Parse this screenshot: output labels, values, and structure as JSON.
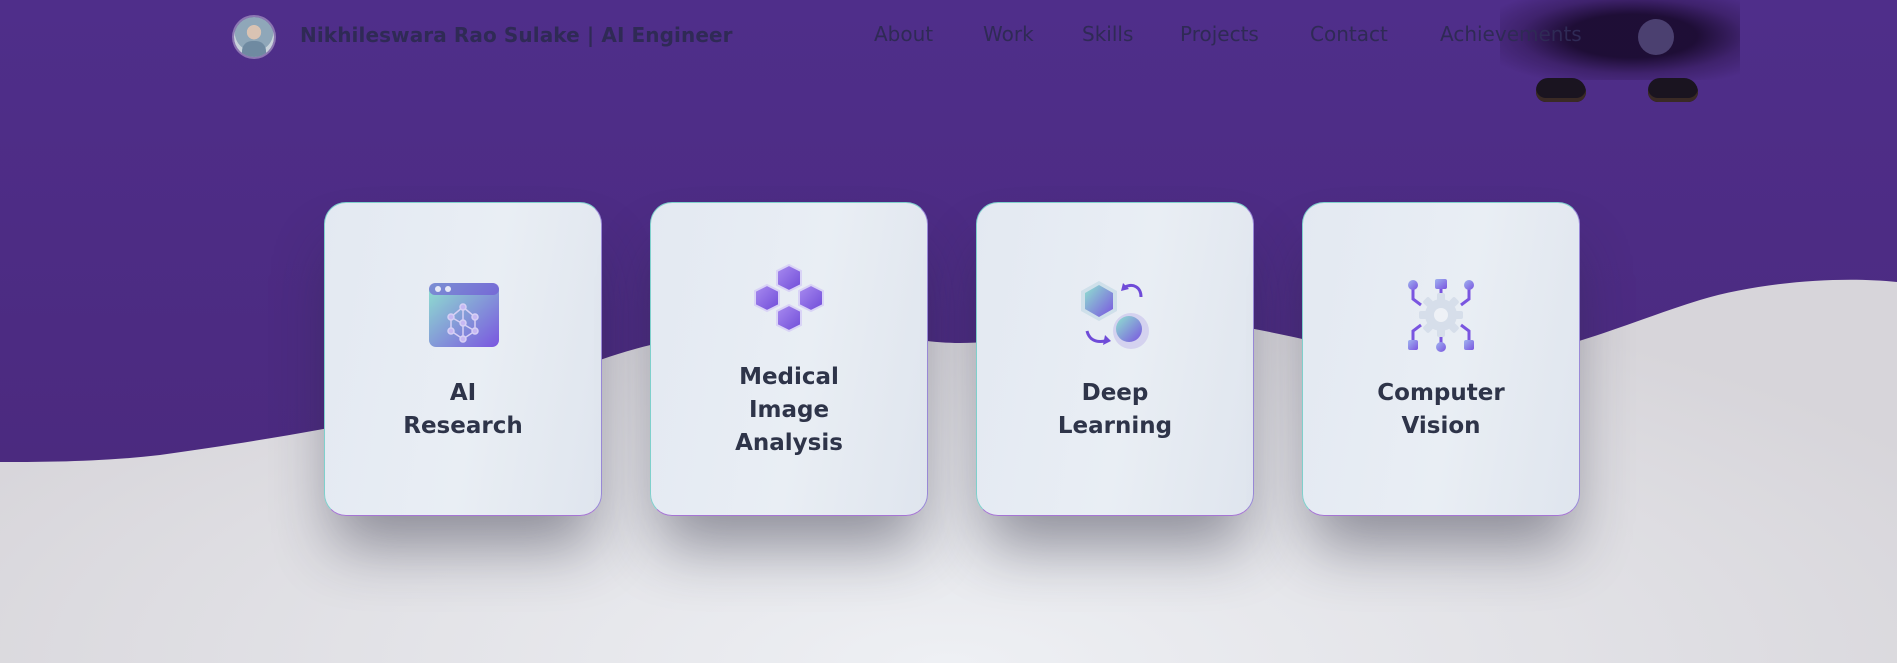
{
  "header": {
    "brand": "Nikhileswara Rao Sulake | AI Engineer",
    "nav": [
      "About",
      "Work",
      "Skills",
      "Projects",
      "Contact",
      "Achievements"
    ]
  },
  "cards": [
    {
      "title": "AI Research",
      "icon": "ai-research-browser-icon"
    },
    {
      "title": "Medical Image Analysis",
      "icon": "cubes-cluster-icon"
    },
    {
      "title": "Deep Learning",
      "icon": "cube-cycle-icon"
    },
    {
      "title": "Computer Vision",
      "icon": "gear-network-icon"
    }
  ],
  "colors": {
    "hero_purple": "#4e2c88",
    "wave_light": "#d9d7dc",
    "card_text": "#2e3449",
    "nav_text": "#2f2a55",
    "icon_teal": "#8fe0d0",
    "icon_violet": "#7a55e0"
  }
}
